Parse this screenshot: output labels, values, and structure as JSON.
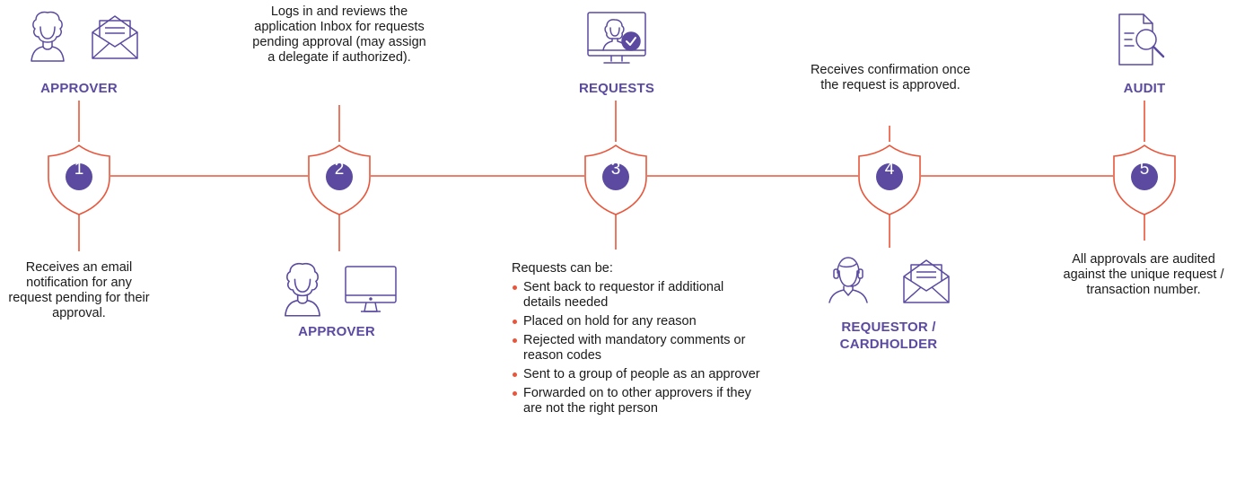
{
  "colors": {
    "line": "#e9553a",
    "shield_fill": "#5b4aa0",
    "label": "#5b4aa0",
    "icon": "#5b4aa0"
  },
  "steps": [
    {
      "number": "1",
      "top_label": "APPROVER",
      "top_icons": [
        "person-icon",
        "envelope-icon"
      ],
      "bottom_text": "Receives an email notification for any request pending for their approval."
    },
    {
      "number": "2",
      "top_text": "Logs in and reviews the application Inbox for requests pending approval (may assign a delegate if authorized).",
      "bottom_label": "APPROVER",
      "bottom_icons": [
        "person-icon",
        "monitor-icon"
      ]
    },
    {
      "number": "3",
      "top_label": "REQUESTS",
      "top_icons": [
        "monitor-person-check-icon"
      ],
      "bottom_intro": "Requests can be:",
      "bullets": [
        "Sent back to requestor if additional details needed",
        "Placed on hold for any reason",
        "Rejected with mandatory comments or reason codes",
        "Sent to a group of people as an approver",
        "Forwarded on to other approvers if they are not the right person"
      ]
    },
    {
      "number": "4",
      "top_text": "Receives confirmation once the request is approved.",
      "bottom_label": "REQUESTOR / CARDHOLDER",
      "bottom_icons": [
        "headset-person-icon",
        "envelope-icon"
      ]
    },
    {
      "number": "5",
      "top_label": "AUDIT",
      "top_icons": [
        "document-search-icon"
      ],
      "bottom_text": "All approvals are audited against the unique request / transaction number."
    }
  ]
}
